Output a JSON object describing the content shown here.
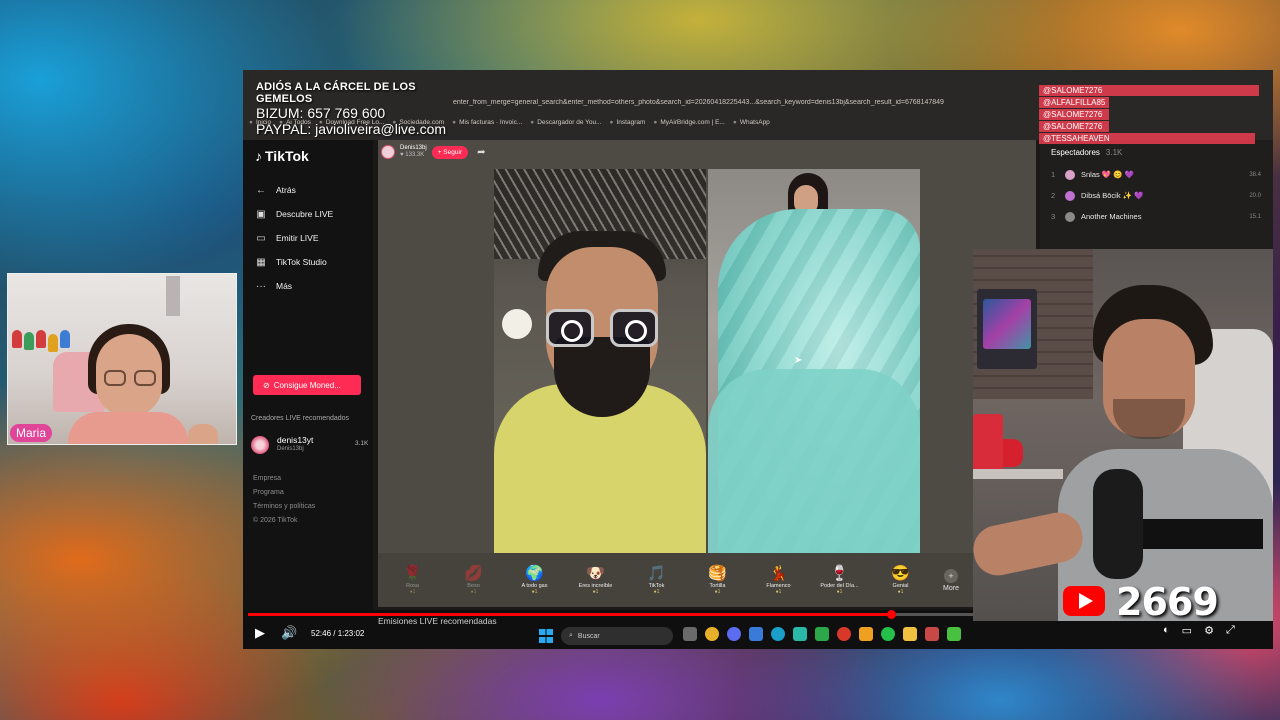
{
  "overlay": {
    "title": "ADIÓS A LA CÁRCEL DE LOS GEMELOS",
    "bizum": "BIZUM: 657 769 600",
    "paypal": "PAYPAL: javioliveira@live.com"
  },
  "guest_cam": {
    "name": "Maria"
  },
  "youtube": {
    "count": "2669"
  },
  "browser": {
    "url": "enter_from_merge=general_search&enter_method=others_photo&search_id=20260418225443...&search_keyword=denis13bj&search_result_id=6768147849",
    "bookmarks": [
      "Inicio",
      "Ai Todos",
      "Download Free Lo...",
      "Sociedade.com",
      "Mis facturas · Invoic...",
      "Descargador de You...",
      "Instagram",
      "MyAirBridge.com | E...",
      "WhatsApp"
    ]
  },
  "tiktok": {
    "logo": "TikTok",
    "nav": [
      {
        "icon": "back-arrow-icon",
        "glyph": "←",
        "label": "Atrás"
      },
      {
        "icon": "discover-live-icon",
        "glyph": "▣",
        "label": "Descubre LIVE"
      },
      {
        "icon": "broadcast-icon",
        "glyph": "▭",
        "label": "Emitir LIVE"
      },
      {
        "icon": "studio-icon",
        "glyph": "▦",
        "label": "TikTok Studio"
      },
      {
        "icon": "more-icon",
        "glyph": "···",
        "label": "Más"
      }
    ],
    "coins_button": "Consigue Moned...",
    "recommended_title": "Creadores LIVE recomendados",
    "recommended": {
      "name": "denis13yt",
      "handle": "Denis13bj",
      "count": "3.1K"
    },
    "footer": [
      "Empresa",
      "Programa",
      "Términos y políticas",
      "© 2026 TikTok"
    ],
    "host": {
      "name": "Denis13bj",
      "likes": "♥ 133.3K",
      "follow": "+ Seguir"
    },
    "gifts": [
      {
        "emoji": "🌹",
        "name": "Rosa",
        "cost": "●1",
        "dim": true
      },
      {
        "emoji": "💋",
        "name": "Beso",
        "cost": "●1",
        "dim": true
      },
      {
        "emoji": "🌍",
        "name": "A todo gas",
        "cost": "●1",
        "dim": false
      },
      {
        "emoji": "🐶",
        "name": "Eres increíble",
        "cost": "●1",
        "dim": false
      },
      {
        "emoji": "🎵",
        "name": "TikTok",
        "cost": "●1",
        "dim": false
      },
      {
        "emoji": "🥞",
        "name": "Tortilla",
        "cost": "●1",
        "dim": false
      },
      {
        "emoji": "💃",
        "name": "Flamenco",
        "cost": "●1",
        "dim": false
      },
      {
        "emoji": "🍷",
        "name": "Poder del Día...",
        "cost": "●1",
        "dim": false
      },
      {
        "emoji": "😎",
        "name": "Genial",
        "cost": "●1",
        "dim": false
      }
    ],
    "more_label": "More",
    "emisiones": "Emisiones LIVE recomendadas"
  },
  "chat": {
    "names": [
      "@SALOME7276",
      "@ALFALFILLA85",
      "@SALOME7276",
      "@SALOME7276",
      "@TESSAHEAVEN"
    ],
    "spectators_title": "Espectadores",
    "spectators_count": "3.1K",
    "spectators": [
      {
        "rank": "1",
        "name": "Snlas 💖 😊 💜",
        "score": "38.4"
      },
      {
        "rank": "2",
        "name": "Dibsá Bōcik ✨ 💜",
        "score": "20.0"
      },
      {
        "rank": "3",
        "name": "Another Machines",
        "score": "15.1"
      }
    ]
  },
  "player": {
    "time": "52:46 / 1:23:02",
    "search_placeholder": "Buscar",
    "progress": 0.63
  }
}
